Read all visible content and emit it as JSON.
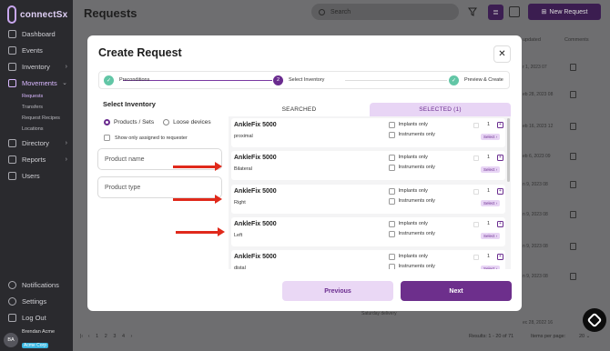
{
  "app": {
    "brand": "connectSx"
  },
  "sidebar": {
    "items": [
      {
        "label": "Dashboard",
        "icon": "dashboard-icon"
      },
      {
        "label": "Events",
        "icon": "events-icon"
      },
      {
        "label": "Inventory",
        "icon": "inventory-icon",
        "expandable": true
      },
      {
        "label": "Movements",
        "icon": "movements-icon",
        "expandable": true,
        "active": true
      }
    ],
    "sub_items": [
      {
        "label": "Requests",
        "active": true
      },
      {
        "label": "Transfers"
      },
      {
        "label": "Request Recipes"
      },
      {
        "label": "Locations"
      }
    ],
    "more_items": [
      {
        "label": "Directory",
        "icon": "directory-icon",
        "expandable": true
      },
      {
        "label": "Reports",
        "icon": "reports-icon",
        "expandable": true
      },
      {
        "label": "Users",
        "icon": "users-icon"
      }
    ],
    "bottom_items": [
      {
        "label": "Notifications",
        "icon": "bell-icon"
      },
      {
        "label": "Settings",
        "icon": "gear-icon"
      },
      {
        "label": "Log Out",
        "icon": "logout-icon"
      }
    ],
    "user": {
      "initials": "BA",
      "name": "Brendan Acme",
      "org": "Acme Corp"
    }
  },
  "header": {
    "title": "Requests",
    "search_placeholder": "Search",
    "new_request_label": "New Request"
  },
  "background_table": {
    "columns": [
      "updated",
      "Comments"
    ],
    "dates": [
      "r 1, 2023 07",
      "eb 28, 2023 08",
      "eb 16, 2023 12",
      "eb 6, 2023 09",
      "n 9, 2023 08",
      "n 9, 2023 08",
      "n 9, 2023 08",
      "n 9, 2023 08",
      "ec 28, 2022 16",
      "ec 28, 2022 16",
      "ec 28, 2022 10"
    ],
    "note": "Saturday delivery",
    "pagination": [
      "1",
      "2",
      "3",
      "4"
    ],
    "results_text": "Results: 1 - 20 of 71",
    "items_per_page_label": "Items per page:",
    "items_per_page_value": "20"
  },
  "modal": {
    "title": "Create Request",
    "steps": [
      {
        "label": "Preconditions",
        "state": "done"
      },
      {
        "label": "Select Inventory",
        "number": "2",
        "state": "current"
      },
      {
        "label": "Preview & Create",
        "state": "done"
      }
    ],
    "select_inventory_title": "Select Inventory",
    "radio_options": [
      {
        "label": "Products / Sets",
        "selected": true
      },
      {
        "label": "Loose devices",
        "selected": false
      }
    ],
    "show_assigned_label": "Show only assigned to requester",
    "product_name_placeholder": "Product name",
    "product_type_placeholder": "Product type",
    "tabs": {
      "searched": "SEARCHED",
      "selected": "SELECTED (1)"
    },
    "results": [
      {
        "name": "AnkleFix 5000",
        "variant": "proximal",
        "qty": "1",
        "select": "Select"
      },
      {
        "name": "AnkleFix 5000",
        "variant": "Bilateral",
        "qty": "1",
        "select": "Select"
      },
      {
        "name": "AnkleFix 5000",
        "variant": "Right",
        "qty": "1",
        "select": "Select"
      },
      {
        "name": "AnkleFix 5000",
        "variant": "Left",
        "qty": "1",
        "select": "Select"
      },
      {
        "name": "AnkleFix 5000",
        "variant": "distal",
        "qty": "1",
        "select": "Select"
      }
    ],
    "option_labels": {
      "implants": "Implants only",
      "instruments": "Instruments only"
    },
    "previous_label": "Previous",
    "next_label": "Next"
  },
  "colors": {
    "brand_purple": "#6a2c8f",
    "tab_selected_bg": "#e8d5f5",
    "step_done": "#62c6a6",
    "annotation_arrow": "#e0291b"
  }
}
